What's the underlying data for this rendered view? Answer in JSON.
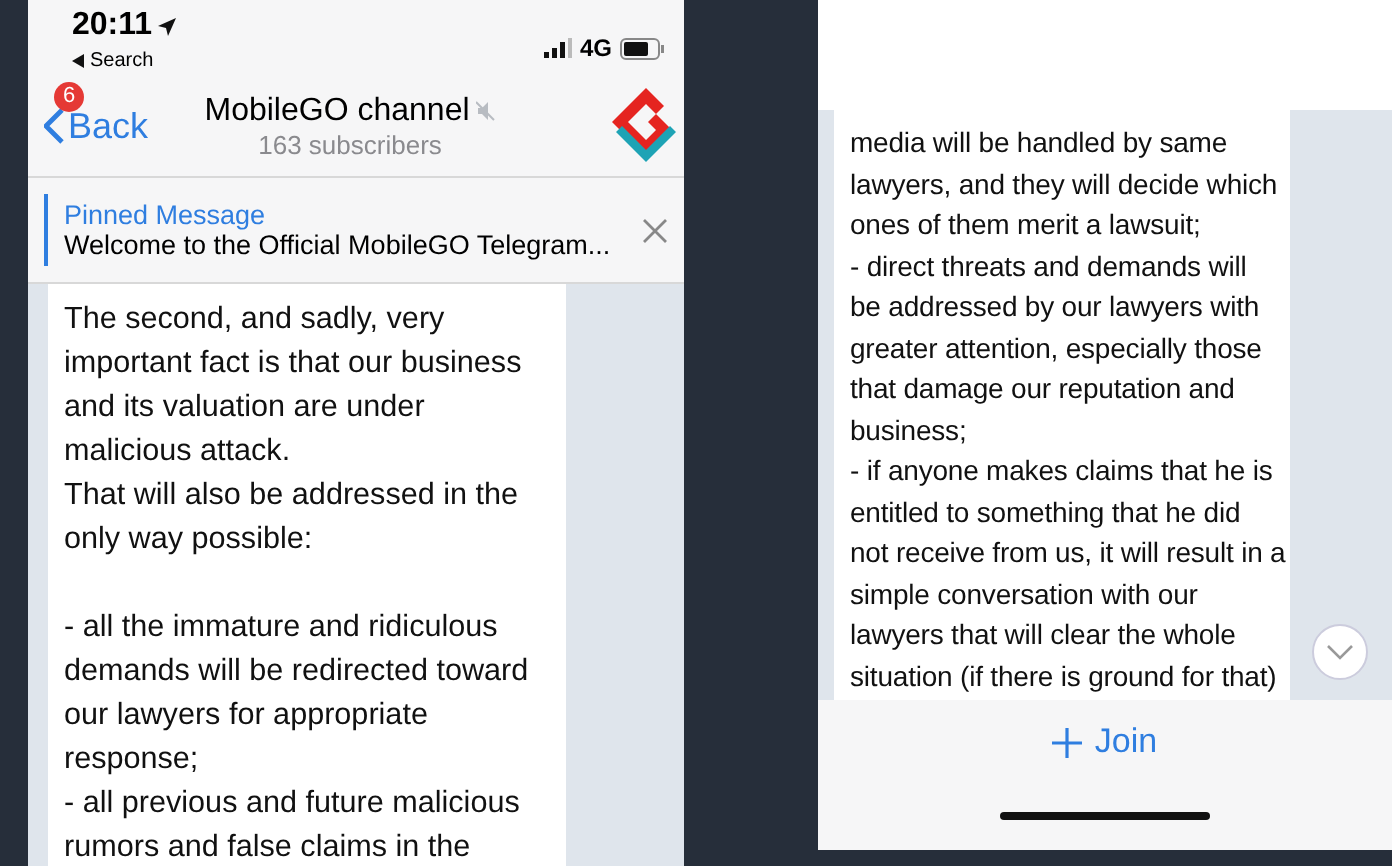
{
  "left_screen": {
    "status_bar": {
      "time": "20:11",
      "back_to_app": "Search",
      "network": "4G"
    },
    "header": {
      "back_label": "Back",
      "unread_badge": "6",
      "title": "MobileGO channel",
      "muted": true,
      "subtitle": "163 subscribers"
    },
    "pinned": {
      "label": "Pinned Message",
      "text": "Welcome to the Official MobileGO Telegram..."
    },
    "message": [
      "The second, and sadly, very\nimportant fact is that our business\nand its valuation are under\nmalicious attack.",
      "That will also be addressed in the\nonly way possible:",
      "- all the immature and ridiculous\ndemands will be redirected toward\nour lawyers for appropriate\nresponse;",
      "- all previous and future malicious\nrumors and false claims in the"
    ]
  },
  "right_screen": {
    "message": [
      "media will be handled by same\nlawyers, and they will decide which\nones of them merit a lawsuit;",
      "- direct threats and demands will\nbe addressed by our lawyers with\ngreater attention, especially those\nthat damage our reputation and\nbusiness;",
      "- if anyone makes claims that he is\nentitled to something that he did\nnot receive from us, it will result in a\nsimple conversation with our\nlawyers that will clear the whole\nsituation (if there is ground for that)"
    ],
    "join_button": "Join"
  }
}
